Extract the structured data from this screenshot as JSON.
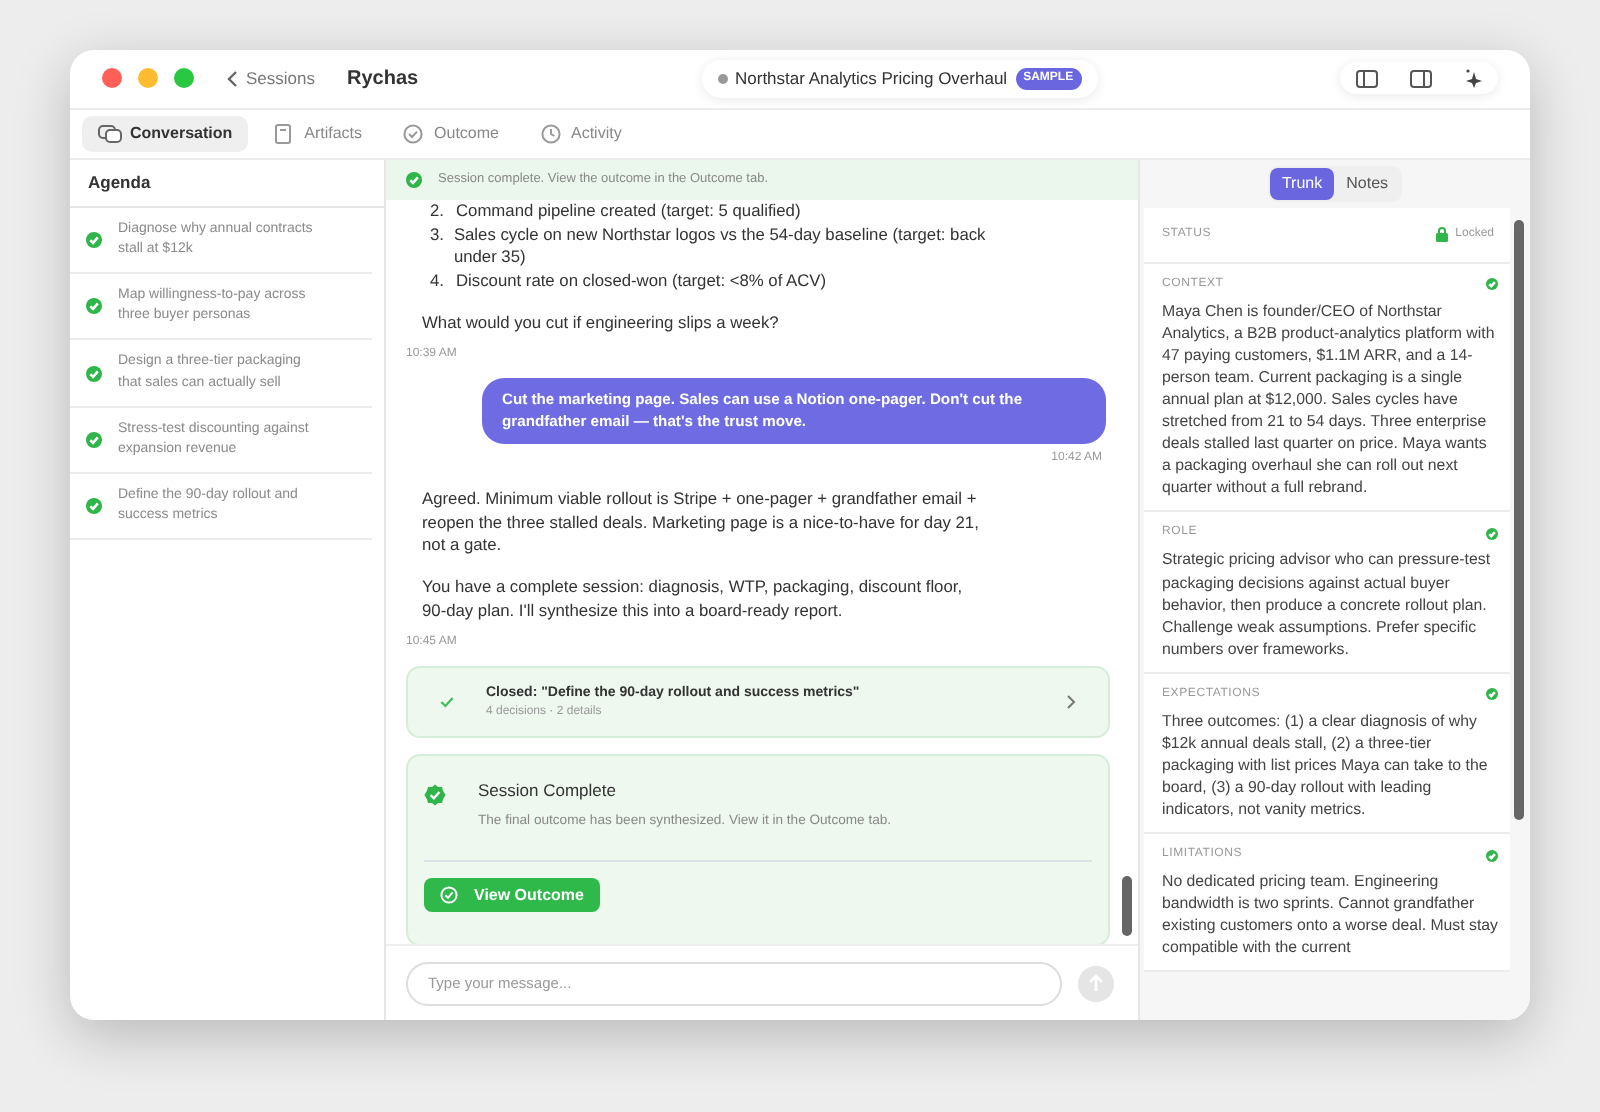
{
  "window": {
    "back_label": "Sessions",
    "title": "Rychas",
    "session_title": "Northstar Analytics Pricing Overhaul",
    "badge": "SAMPLE"
  },
  "tabs": [
    {
      "label": "Conversation",
      "kind": "chat",
      "selected": true
    },
    {
      "label": "Artifacts",
      "kind": "doc",
      "selected": false
    },
    {
      "label": "Outcome",
      "kind": "check",
      "selected": false
    },
    {
      "label": "Activity",
      "kind": "clock",
      "selected": false
    }
  ],
  "agenda": {
    "title": "Agenda",
    "items": [
      {
        "text": "Diagnose why annual contracts stall at $12k",
        "done": true
      },
      {
        "text": "Map willingness-to-pay across three buyer personas",
        "done": true
      },
      {
        "text": "Design a three-tier packaging that sales can actually sell",
        "done": true
      },
      {
        "text": "Stress-test discounting against expansion revenue",
        "done": true
      },
      {
        "text": "Define the 90-day rollout and success metrics",
        "done": true
      }
    ]
  },
  "banner": "Session complete. View the outcome in the Outcome tab.",
  "messages": [
    {
      "kind": "assistant",
      "list": [
        {
          "number": "2.",
          "text": "Command pipeline created (target: 5 qualified)"
        },
        {
          "number": "3.",
          "text": "Sales cycle on new Northstar logos vs the 54-day baseline (target: back under 35)"
        },
        {
          "number": "4.",
          "text": "Discount rate on closed-won (target: <8% of ACV)"
        }
      ],
      "paragraphs": [
        "What would you cut if engineering slips a week?"
      ],
      "time": "10:39 AM"
    },
    {
      "kind": "user",
      "text": "Cut the marketing page. Sales can use a Notion one-pager. Don't cut the grandfather email — that's the trust move.",
      "time": "10:42 AM"
    },
    {
      "kind": "assistant",
      "paragraphs": [
        "Agreed. Minimum viable rollout is Stripe + one-pager + grandfather email + reopen the three stalled deals. Marketing page is a nice-to-have for day 21, not a gate.",
        "You have a complete session: diagnosis, WTP, packaging, discount floor, 90-day plan. I'll synthesize this into a board-ready report."
      ],
      "time": "10:45 AM"
    }
  ],
  "closed_card": {
    "title": "Closed: \"Define the 90-day rollout and success metrics\"",
    "subtitle": "4 decisions · 2 details"
  },
  "complete_card": {
    "title": "Session Complete",
    "text": "The final outcome has been synthesized. View it in the Outcome tab.",
    "button": "View Outcome"
  },
  "composer": {
    "placeholder": "Type your message..."
  },
  "panel_tabs": [
    {
      "label": "Trunk",
      "selected": true
    },
    {
      "label": "Notes",
      "selected": false
    }
  ],
  "status": {
    "label": "STATUS",
    "value": "Locked",
    "locked": true
  },
  "sections": [
    {
      "label": "CONTEXT",
      "done": true,
      "text": "Maya Chen is founder/CEO of Northstar Analytics, a B2B product-analytics platform with 47 paying customers, $1.1M ARR, and a 14-person team. Current packaging is a single annual plan at $12,000. Sales cycles have stretched from 21 to 54 days. Three enterprise deals stalled last quarter on price. Maya wants a packaging overhaul she can roll out next quarter without a full rebrand."
    },
    {
      "label": "ROLE",
      "done": true,
      "text": "Strategic pricing advisor who can pressure-test packaging decisions against actual buyer behavior, then produce a concrete rollout plan. Challenge weak assumptions. Prefer specific numbers over frameworks."
    },
    {
      "label": "EXPECTATIONS",
      "done": true,
      "text": "Three outcomes: (1) a clear diagnosis of why $12k annual deals stall, (2) a three-tier packaging with list prices Maya can take to the board, (3) a 90-day rollout with leading indicators, not vanity metrics."
    },
    {
      "label": "LIMITATIONS",
      "done": true,
      "text": "No dedicated pricing team. Engineering bandwidth is two sprints. Cannot grandfather existing customers onto a worse deal. Must stay compatible with the current"
    }
  ]
}
